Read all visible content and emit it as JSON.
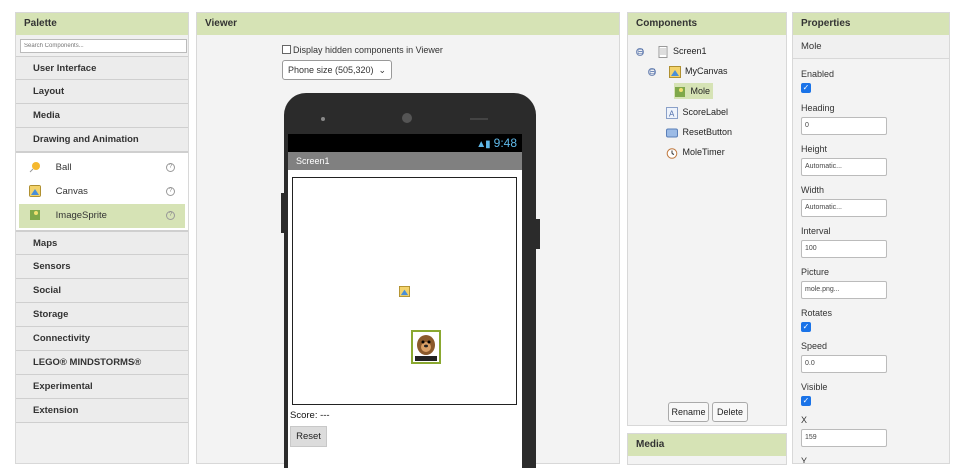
{
  "palette": {
    "title": "Palette",
    "search_placeholder": "Search Components...",
    "categories_top": [
      "User Interface",
      "Layout",
      "Media",
      "Drawing and Animation"
    ],
    "drawing_items": [
      {
        "label": "Ball",
        "icon": "ball-icon"
      },
      {
        "label": "Canvas",
        "icon": "canvas-icon"
      },
      {
        "label": "ImageSprite",
        "icon": "imagesprite-icon"
      }
    ],
    "help_glyph": "?",
    "categories_bottom": [
      "Maps",
      "Sensors",
      "Social",
      "Storage",
      "Connectivity",
      "LEGO® MINDSTORMS®",
      "Experimental",
      "Extension"
    ]
  },
  "viewer": {
    "title": "Viewer",
    "hidden_components_label": "Display hidden components in Viewer",
    "phone_size": "Phone size (505,320)",
    "clock": "9:48",
    "screen_title": "Screen1",
    "score_text": "Score: ---",
    "reset_label": "Reset"
  },
  "components": {
    "title": "Components",
    "tree": [
      {
        "label": "Screen1",
        "icon": "screen-icon",
        "toggle": "⊟"
      },
      {
        "label": "MyCanvas",
        "icon": "canvas-icon",
        "toggle": "⊟"
      },
      {
        "label": "Mole",
        "icon": "imagesprite-icon"
      },
      {
        "label": "ScoreLabel",
        "icon": "label-icon"
      },
      {
        "label": "ResetButton",
        "icon": "button-icon"
      },
      {
        "label": "MoleTimer",
        "icon": "clock-icon"
      }
    ],
    "rename_label": "Rename",
    "delete_label": "Delete"
  },
  "media": {
    "title": "Media"
  },
  "properties": {
    "title": "Properties",
    "component": "Mole",
    "items": [
      {
        "label": "Enabled",
        "type": "checkbox",
        "checked": true
      },
      {
        "label": "Heading",
        "type": "text",
        "value": "0"
      },
      {
        "label": "Height",
        "type": "text",
        "value": "Automatic..."
      },
      {
        "label": "Width",
        "type": "text",
        "value": "Automatic..."
      },
      {
        "label": "Interval",
        "type": "text",
        "value": "100"
      },
      {
        "label": "Picture",
        "type": "text",
        "value": "mole.png..."
      },
      {
        "label": "Rotates",
        "type": "checkbox",
        "checked": true
      },
      {
        "label": "Speed",
        "type": "text",
        "value": "0.0"
      },
      {
        "label": "Visible",
        "type": "checkbox",
        "checked": true
      },
      {
        "label": "X",
        "type": "text",
        "value": "159"
      },
      {
        "label": "Y",
        "type": "text",
        "value": ""
      }
    ]
  },
  "colors": {
    "panel_header": "#d6e3b5",
    "selection": "#d6e3b5",
    "checkbox": "#1a73e8",
    "status_icons": "#5fb8e8"
  }
}
